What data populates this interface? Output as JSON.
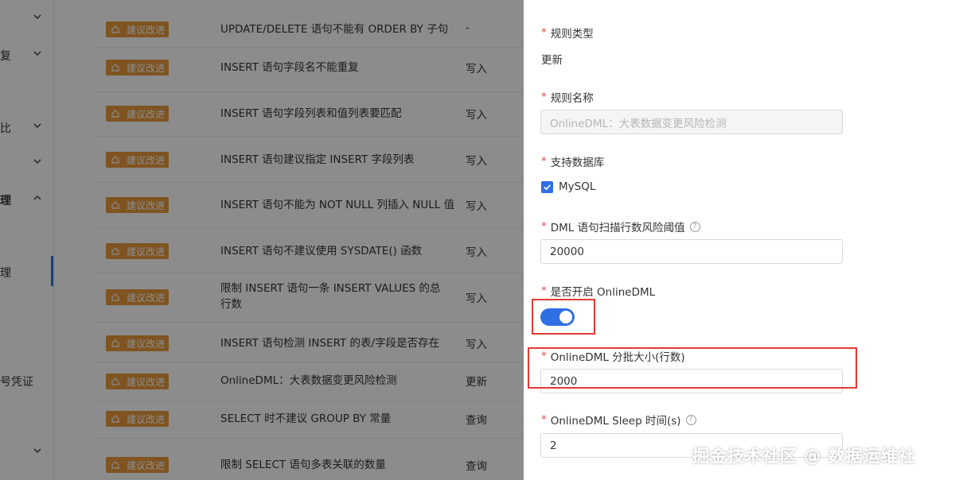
{
  "sidebar": {
    "items": [
      {
        "label": "",
        "has_chevron": true,
        "chevron": "down"
      },
      {
        "label": "复",
        "has_chevron": true,
        "chevron": "down"
      },
      {
        "label": "比",
        "has_chevron": true,
        "chevron": "down"
      },
      {
        "label": "",
        "has_chevron": true,
        "chevron": "down"
      },
      {
        "label": "理",
        "has_chevron": true,
        "chevron": "up"
      },
      {
        "label": "理",
        "has_chevron": false
      },
      {
        "label": "号凭证",
        "has_chevron": false
      },
      {
        "label": "",
        "has_chevron": true,
        "chevron": "down"
      }
    ]
  },
  "table": {
    "badge_label": "建议改进",
    "rows": [
      {
        "name": "UPDATE/DELETE 语句不能有 ORDER BY 子句",
        "type": "-"
      },
      {
        "name": "INSERT 语句字段名不能重复",
        "type": "写入"
      },
      {
        "name": "INSERT 语句字段列表和值列表要匹配",
        "type": "写入"
      },
      {
        "name": "INSERT 语句建议指定 INSERT 字段列表",
        "type": "写入"
      },
      {
        "name": "INSERT 语句不能为 NOT NULL 列插入 NULL 值",
        "type": "写入"
      },
      {
        "name": "INSERT 语句不建议使用 SYSDATE() 函数",
        "type": "写入"
      },
      {
        "name": "限制 INSERT 语句一条 INSERT VALUES 的总行数",
        "type": "写入"
      },
      {
        "name": "INSERT 语句检测 INSERT 的表/字段是否存在",
        "type": "写入"
      },
      {
        "name": "OnlineDML：大表数据变更风险检测",
        "type": "更新"
      },
      {
        "name": "SELECT 时不建议 GROUP BY 常量",
        "type": "查询"
      },
      {
        "name": "限制 SELECT 语句多表关联的数量",
        "type": "查询"
      }
    ]
  },
  "drawer": {
    "rule_type_label": "规则类型",
    "rule_type_value": "更新",
    "rule_name_label": "规则名称",
    "rule_name_value": "OnlineDML：大表数据变更风险检测",
    "db_label": "支持数据库",
    "db_option": "MySQL",
    "db_checked": true,
    "threshold_label": "DML 语句扫描行数风险阈值",
    "threshold_value": "20000",
    "enable_label": "是否开启 OnlineDML",
    "enable_on": true,
    "batch_label": "OnlineDML 分批大小(行数)",
    "batch_value": "2000",
    "sleep_label": "OnlineDML Sleep 时间(s)",
    "sleep_value": "2"
  },
  "colors": {
    "accent": "#2f6fe4",
    "badge": "#e89a3c",
    "highlight": "#e53935",
    "required": "#e5484d"
  },
  "watermark": "掘金技术社区 @ 数据运维社"
}
